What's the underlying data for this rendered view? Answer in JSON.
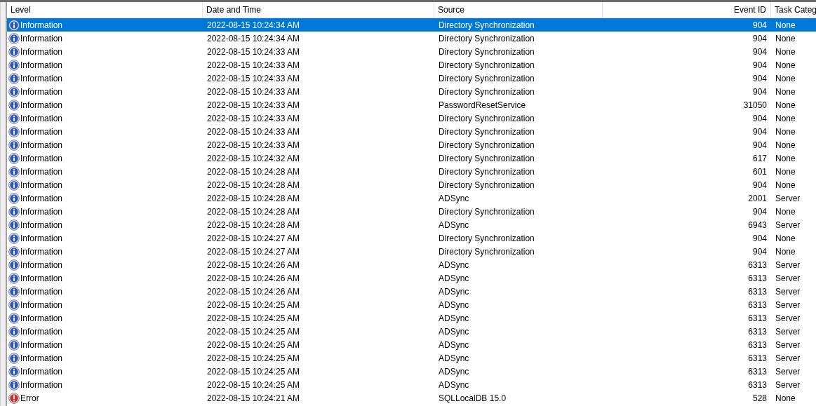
{
  "columns": [
    "Level",
    "Date and Time",
    "Source",
    "Event ID",
    "Task Categ"
  ],
  "rows": [
    {
      "kind": "information",
      "level": "Information",
      "date_time": "2022-08-15 10:24:34 AM",
      "source": "Directory Synchronization",
      "event_id": "904",
      "task_category": "None",
      "selected": true
    },
    {
      "kind": "information",
      "level": "Information",
      "date_time": "2022-08-15 10:24:34 AM",
      "source": "Directory Synchronization",
      "event_id": "904",
      "task_category": "None",
      "selected": false
    },
    {
      "kind": "information",
      "level": "Information",
      "date_time": "2022-08-15 10:24:33 AM",
      "source": "Directory Synchronization",
      "event_id": "904",
      "task_category": "None",
      "selected": false
    },
    {
      "kind": "information",
      "level": "Information",
      "date_time": "2022-08-15 10:24:33 AM",
      "source": "Directory Synchronization",
      "event_id": "904",
      "task_category": "None",
      "selected": false
    },
    {
      "kind": "information",
      "level": "Information",
      "date_time": "2022-08-15 10:24:33 AM",
      "source": "Directory Synchronization",
      "event_id": "904",
      "task_category": "None",
      "selected": false
    },
    {
      "kind": "information",
      "level": "Information",
      "date_time": "2022-08-15 10:24:33 AM",
      "source": "Directory Synchronization",
      "event_id": "904",
      "task_category": "None",
      "selected": false
    },
    {
      "kind": "information",
      "level": "Information",
      "date_time": "2022-08-15 10:24:33 AM",
      "source": "PasswordResetService",
      "event_id": "31050",
      "task_category": "None",
      "selected": false
    },
    {
      "kind": "information",
      "level": "Information",
      "date_time": "2022-08-15 10:24:33 AM",
      "source": "Directory Synchronization",
      "event_id": "904",
      "task_category": "None",
      "selected": false
    },
    {
      "kind": "information",
      "level": "Information",
      "date_time": "2022-08-15 10:24:33 AM",
      "source": "Directory Synchronization",
      "event_id": "904",
      "task_category": "None",
      "selected": false
    },
    {
      "kind": "information",
      "level": "Information",
      "date_time": "2022-08-15 10:24:33 AM",
      "source": "Directory Synchronization",
      "event_id": "904",
      "task_category": "None",
      "selected": false
    },
    {
      "kind": "information",
      "level": "Information",
      "date_time": "2022-08-15 10:24:32 AM",
      "source": "Directory Synchronization",
      "event_id": "617",
      "task_category": "None",
      "selected": false
    },
    {
      "kind": "information",
      "level": "Information",
      "date_time": "2022-08-15 10:24:28 AM",
      "source": "Directory Synchronization",
      "event_id": "601",
      "task_category": "None",
      "selected": false
    },
    {
      "kind": "information",
      "level": "Information",
      "date_time": "2022-08-15 10:24:28 AM",
      "source": "Directory Synchronization",
      "event_id": "904",
      "task_category": "None",
      "selected": false
    },
    {
      "kind": "information",
      "level": "Information",
      "date_time": "2022-08-15 10:24:28 AM",
      "source": "ADSync",
      "event_id": "2001",
      "task_category": "Server",
      "selected": false
    },
    {
      "kind": "information",
      "level": "Information",
      "date_time": "2022-08-15 10:24:28 AM",
      "source": "Directory Synchronization",
      "event_id": "904",
      "task_category": "None",
      "selected": false
    },
    {
      "kind": "information",
      "level": "Information",
      "date_time": "2022-08-15 10:24:28 AM",
      "source": "ADSync",
      "event_id": "6943",
      "task_category": "Server",
      "selected": false
    },
    {
      "kind": "information",
      "level": "Information",
      "date_time": "2022-08-15 10:24:27 AM",
      "source": "Directory Synchronization",
      "event_id": "904",
      "task_category": "None",
      "selected": false
    },
    {
      "kind": "information",
      "level": "Information",
      "date_time": "2022-08-15 10:24:27 AM",
      "source": "Directory Synchronization",
      "event_id": "904",
      "task_category": "None",
      "selected": false
    },
    {
      "kind": "information",
      "level": "Information",
      "date_time": "2022-08-15 10:24:26 AM",
      "source": "ADSync",
      "event_id": "6313",
      "task_category": "Server",
      "selected": false
    },
    {
      "kind": "information",
      "level": "Information",
      "date_time": "2022-08-15 10:24:26 AM",
      "source": "ADSync",
      "event_id": "6313",
      "task_category": "Server",
      "selected": false
    },
    {
      "kind": "information",
      "level": "Information",
      "date_time": "2022-08-15 10:24:26 AM",
      "source": "ADSync",
      "event_id": "6313",
      "task_category": "Server",
      "selected": false
    },
    {
      "kind": "information",
      "level": "Information",
      "date_time": "2022-08-15 10:24:25 AM",
      "source": "ADSync",
      "event_id": "6313",
      "task_category": "Server",
      "selected": false
    },
    {
      "kind": "information",
      "level": "Information",
      "date_time": "2022-08-15 10:24:25 AM",
      "source": "ADSync",
      "event_id": "6313",
      "task_category": "Server",
      "selected": false
    },
    {
      "kind": "information",
      "level": "Information",
      "date_time": "2022-08-15 10:24:25 AM",
      "source": "ADSync",
      "event_id": "6313",
      "task_category": "Server",
      "selected": false
    },
    {
      "kind": "information",
      "level": "Information",
      "date_time": "2022-08-15 10:24:25 AM",
      "source": "ADSync",
      "event_id": "6313",
      "task_category": "Server",
      "selected": false
    },
    {
      "kind": "information",
      "level": "Information",
      "date_time": "2022-08-15 10:24:25 AM",
      "source": "ADSync",
      "event_id": "6313",
      "task_category": "Server",
      "selected": false
    },
    {
      "kind": "information",
      "level": "Information",
      "date_time": "2022-08-15 10:24:25 AM",
      "source": "ADSync",
      "event_id": "6313",
      "task_category": "Server",
      "selected": false
    },
    {
      "kind": "information",
      "level": "Information",
      "date_time": "2022-08-15 10:24:25 AM",
      "source": "ADSync",
      "event_id": "6313",
      "task_category": "Server",
      "selected": false
    },
    {
      "kind": "error",
      "level": "Error",
      "date_time": "2022-08-15 10:24:21 AM",
      "source": "SQLLocalDB 15.0",
      "event_id": "528",
      "task_category": "None",
      "selected": false
    }
  ]
}
